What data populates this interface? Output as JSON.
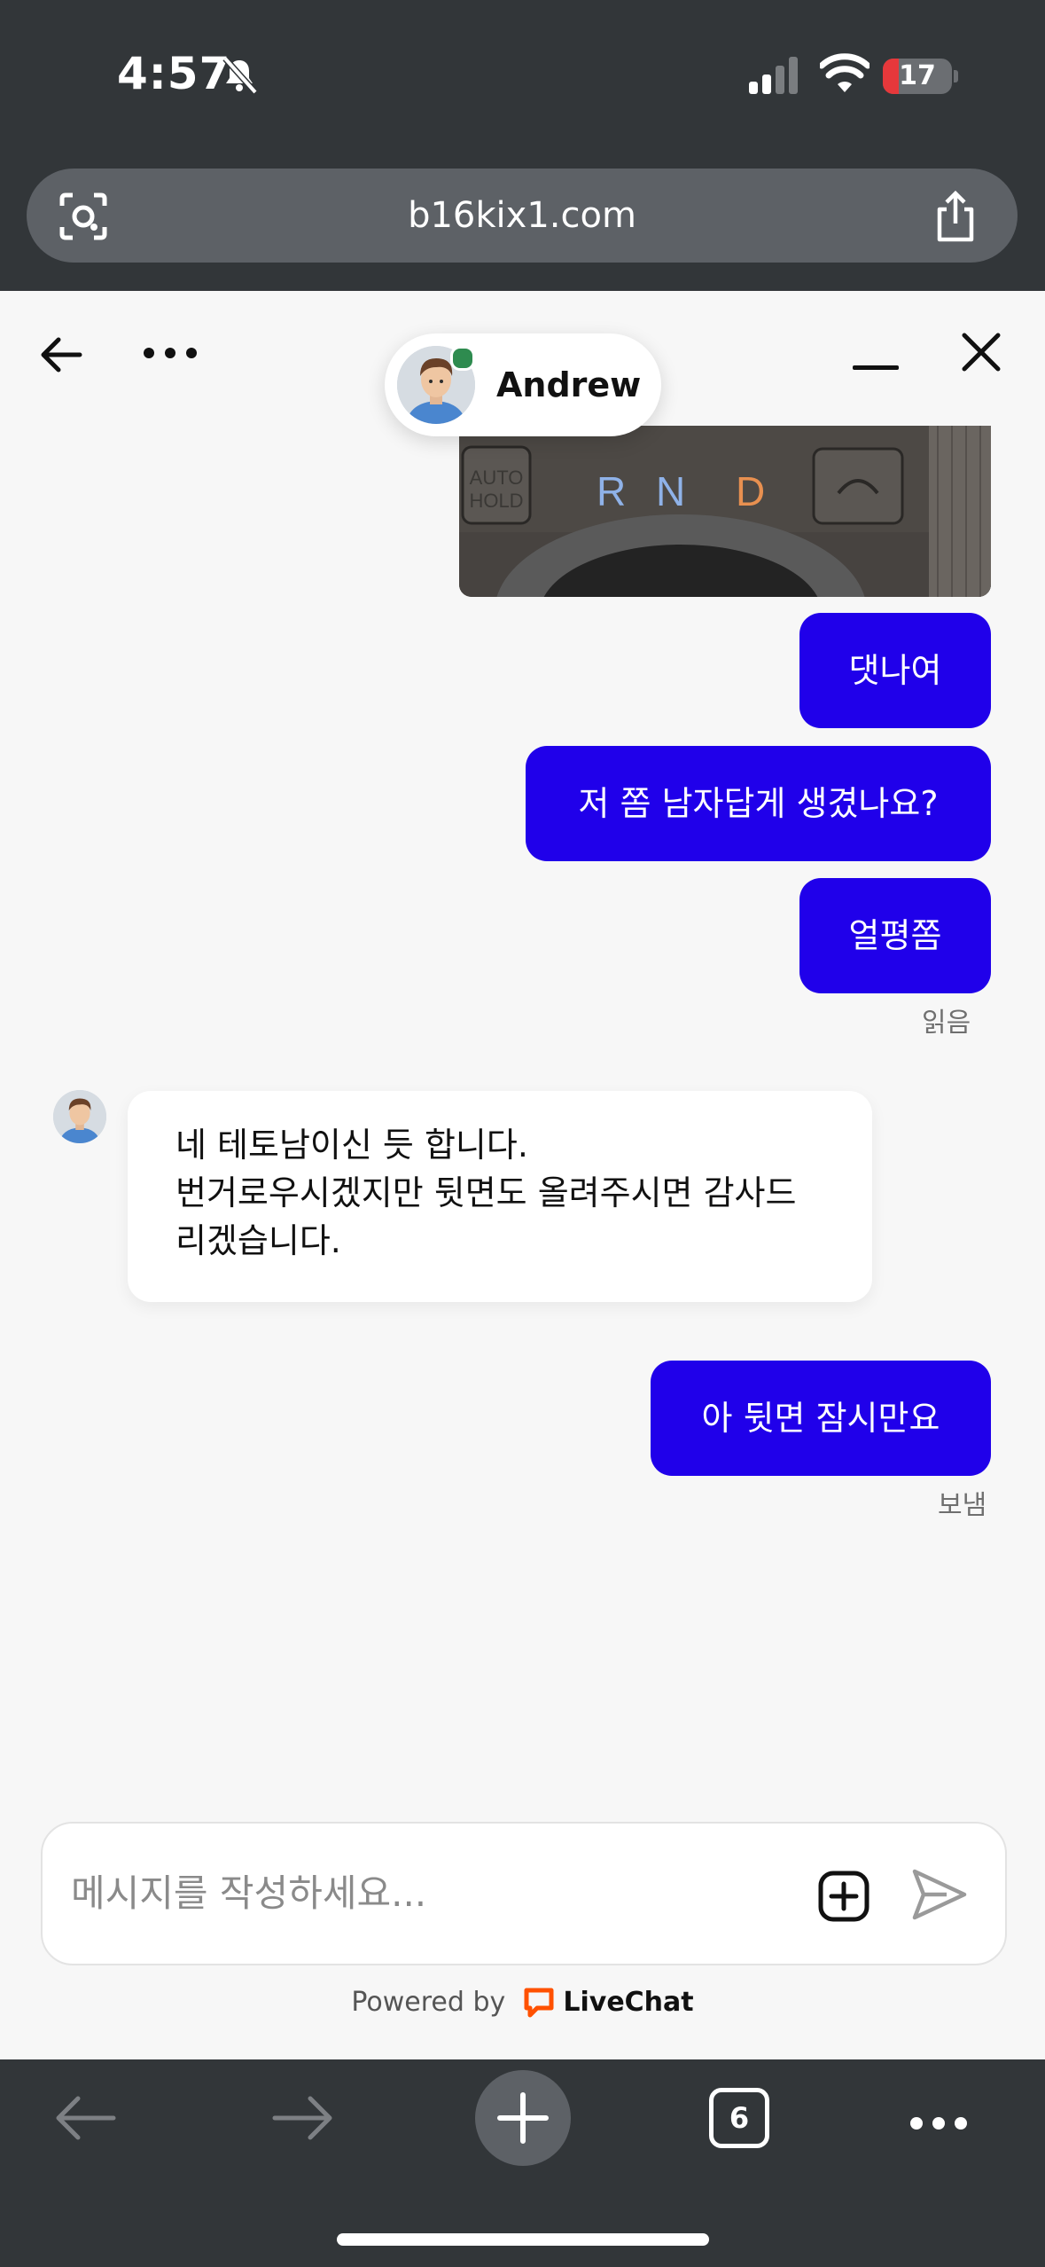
{
  "status_bar": {
    "time": "4:57",
    "battery": "17"
  },
  "browser": {
    "url": "b16kix1.com",
    "tab_count": "6"
  },
  "chat": {
    "agent_name": "Andrew",
    "photo": {
      "gear_labels": [
        "AUTO",
        "HOLD",
        "R",
        "N",
        "D"
      ]
    },
    "messages_out": [
      {
        "text": "댓나여"
      },
      {
        "text": "저 쫌 남자답게 생겼나요?"
      },
      {
        "text": "얼평쫌"
      }
    ],
    "read_status": "읽음",
    "message_in": {
      "lines": [
        "네 테토남이신 듯 합니다.",
        "번거로우시겠지만 뒷면도 올려주시면 감사드",
        "리겠습니다."
      ]
    },
    "last_message": "아 뒷면 잠시만요",
    "sent_status": "보냄"
  },
  "composer": {
    "placeholder": "메시지를 작성하세요..."
  },
  "footer": {
    "powered_by": "Powered by",
    "brand": "LiveChat"
  },
  "colors": {
    "accent": "#2000ea",
    "bars": "#323639",
    "online": "#2e8b4f",
    "brand": "#ff5100"
  }
}
